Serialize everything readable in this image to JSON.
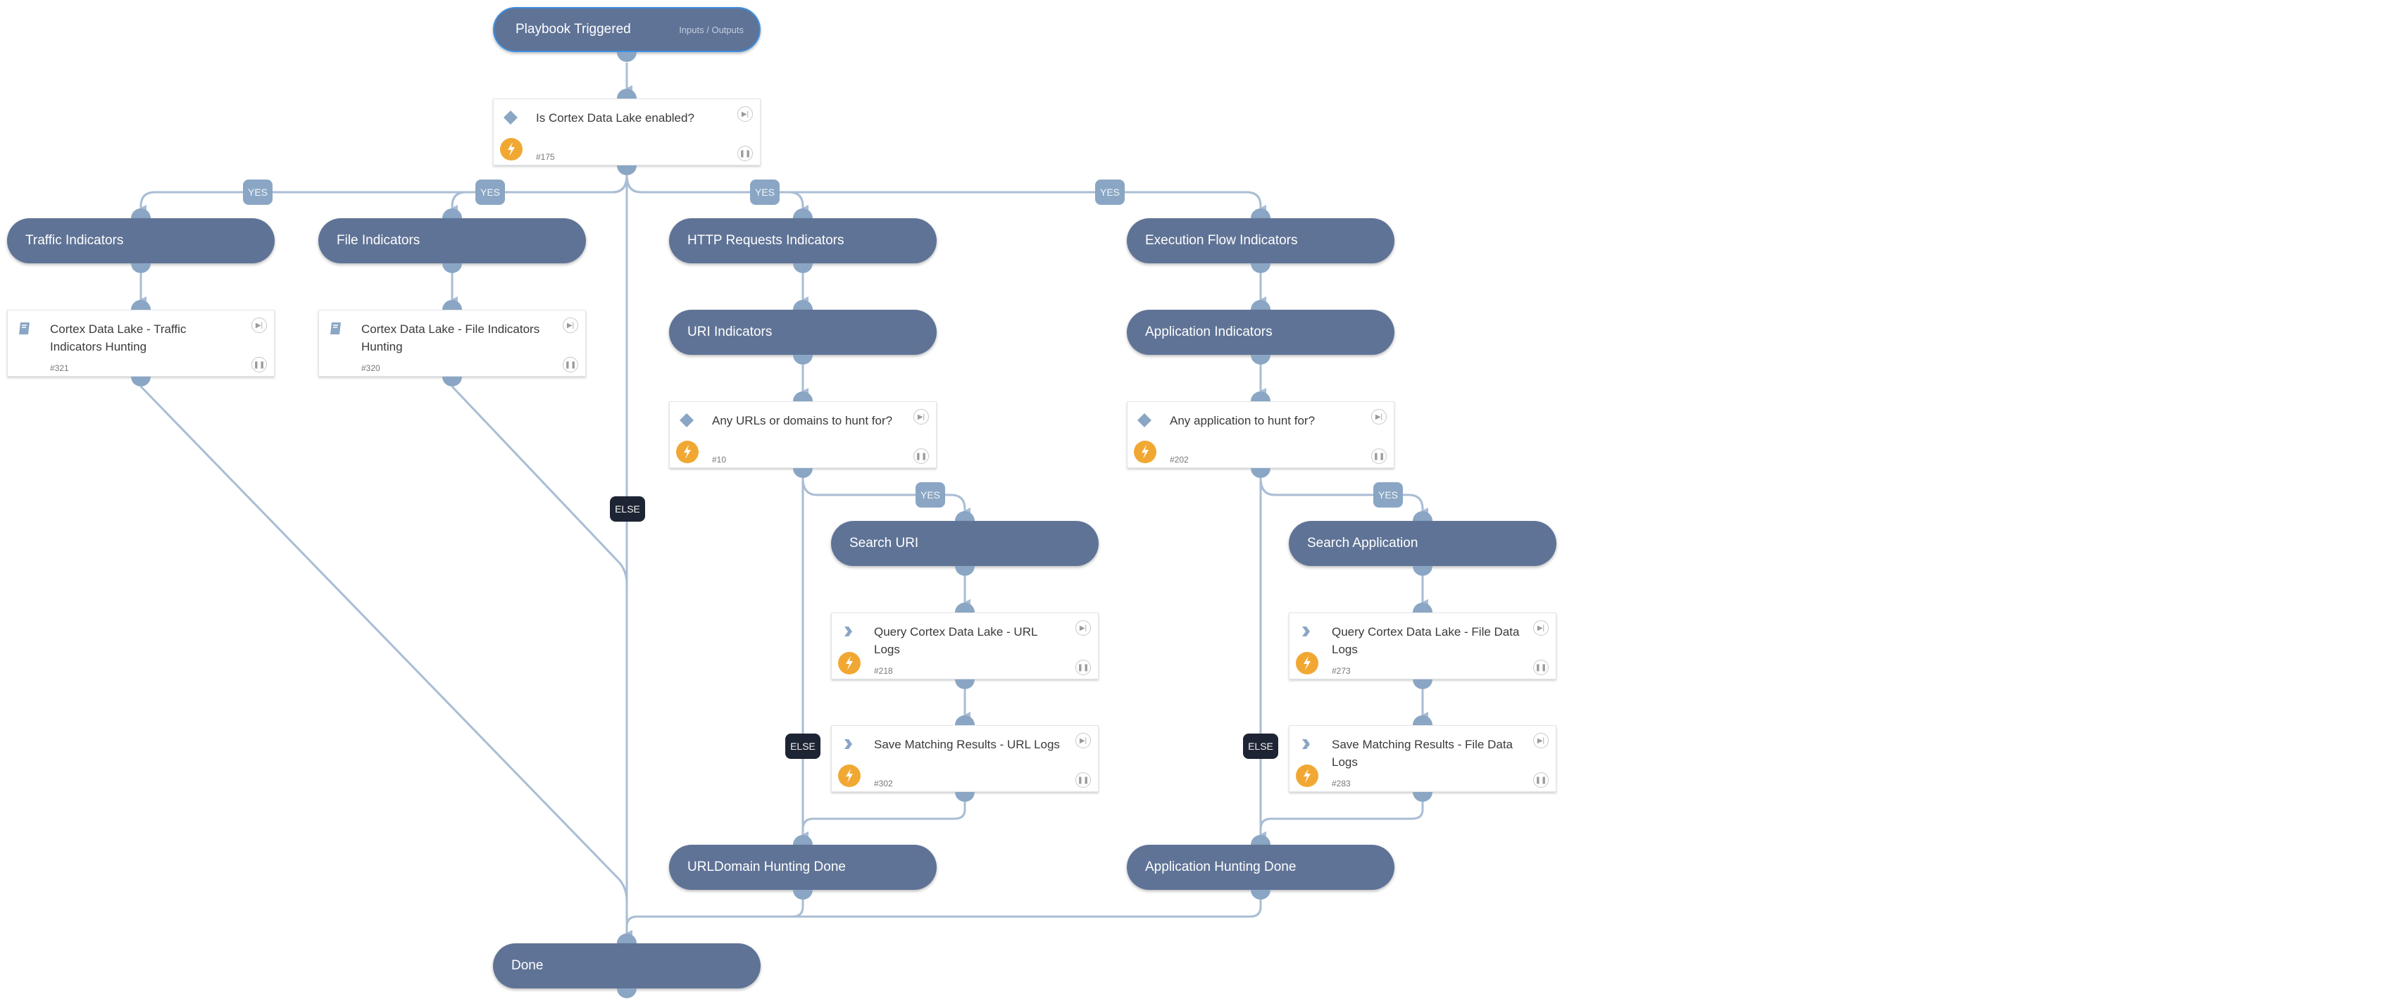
{
  "trigger": {
    "title": "Playbook Triggered",
    "io_link": "Inputs / Outputs"
  },
  "decisions": {
    "cdl_enabled": {
      "title": "Is Cortex Data Lake enabled?",
      "id": "#175"
    },
    "urls": {
      "title": "Any URLs or domains to hunt for?",
      "id": "#10"
    },
    "apps": {
      "title": "Any application to hunt for?",
      "id": "#202"
    }
  },
  "sections": {
    "traffic": "Traffic Indicators",
    "file": "File Indicators",
    "http": "HTTP Requests Indicators",
    "exec": "Execution Flow Indicators",
    "uri": "URI Indicators",
    "app": "Application Indicators",
    "search_uri": "Search URI",
    "search_app": "Search Application",
    "url_done": "URLDomain Hunting Done",
    "app_done": "Application Hunting Done",
    "done": "Done"
  },
  "tasks": {
    "traffic_hunt": {
      "title": "Cortex Data Lake - Traffic Indicators Hunting",
      "id": "#321",
      "kind": "playbook"
    },
    "file_hunt": {
      "title": "Cortex Data Lake - File Indicators Hunting",
      "id": "#320",
      "kind": "playbook"
    },
    "query_url": {
      "title": "Query Cortex Data Lake - URL Logs",
      "id": "#218",
      "kind": "automation"
    },
    "save_url": {
      "title": "Save Matching Results - URL Logs",
      "id": "#302",
      "kind": "automation"
    },
    "query_file": {
      "title": "Query Cortex Data Lake - File Data Logs",
      "id": "#273",
      "kind": "automation"
    },
    "save_file": {
      "title": "Save Matching Results - File Data Logs",
      "id": "#283",
      "kind": "automation"
    }
  },
  "edge_labels": {
    "yes": "YES",
    "else": "ELSE"
  },
  "icons": {
    "skip": "skip-icon",
    "pause": "pause-icon",
    "conditional": "diamond-icon",
    "playbook": "book-icon",
    "automation": "chevron-right-icon",
    "bolt": "lightning-icon"
  },
  "colors": {
    "section": "#5f7396",
    "edge": "#a9bdd4",
    "port": "#8aa6c4",
    "yes_label": "#8aa6c4",
    "else_label": "#1d2433",
    "bolt": "#f1a833",
    "trigger_border": "#3d8fe0"
  }
}
